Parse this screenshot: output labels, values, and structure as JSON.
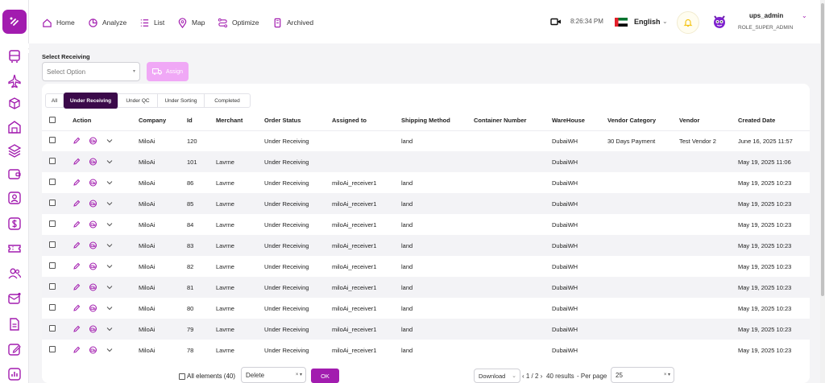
{
  "nav": {
    "home": "Home",
    "analyze": "Analyze",
    "list": "List",
    "map": "Map",
    "optimize": "Optimize",
    "archived": "Archived"
  },
  "header": {
    "time": "8:26:34 PM",
    "language": "English",
    "username": "ups_admin",
    "role": "ROLE_SUPER_ADMIN"
  },
  "filter": {
    "label": "Select Receiving",
    "placeholder": "Select Option",
    "assign_label": "Assign"
  },
  "tabs": [
    "All",
    "Under Receiving",
    "Under QC",
    "Under Sorting",
    "Completed"
  ],
  "active_tab": "Under Receiving",
  "table": {
    "columns": [
      "Action",
      "Company",
      "Id",
      "Merchant",
      "Order Status",
      "Assigned to",
      "Shipping Method",
      "Container Number",
      "WareHouse",
      "Vendor Category",
      "Vendor",
      "Created Date"
    ],
    "rows": [
      [
        "MiloAi",
        "120",
        "",
        "Under Receiving",
        "",
        "land",
        "",
        "DubaiWH",
        "30 Days Payment",
        "Test Vendor 2",
        "June 16, 2025 11:57"
      ],
      [
        "MiloAi",
        "101",
        "Lavrne",
        "Under Receiving",
        "",
        "",
        "",
        "DubaiWH",
        "",
        "",
        "May 19, 2025 11:06"
      ],
      [
        "MiloAi",
        "86",
        "Lavrne",
        "Under Receiving",
        "miloAi_receiver1",
        "land",
        "",
        "DubaiWH",
        "",
        "",
        "May 19, 2025 10:23"
      ],
      [
        "MiloAi",
        "85",
        "Lavrne",
        "Under Receiving",
        "miloAi_receiver1",
        "land",
        "",
        "DubaiWH",
        "",
        "",
        "May 19, 2025 10:23"
      ],
      [
        "MiloAi",
        "84",
        "Lavrne",
        "Under Receiving",
        "miloAi_receiver1",
        "land",
        "",
        "DubaiWH",
        "",
        "",
        "May 19, 2025 10:23"
      ],
      [
        "MiloAi",
        "83",
        "Lavrne",
        "Under Receiving",
        "miloAi_receiver1",
        "land",
        "",
        "DubaiWH",
        "",
        "",
        "May 19, 2025 10:23"
      ],
      [
        "MiloAi",
        "82",
        "Lavrne",
        "Under Receiving",
        "miloAi_receiver1",
        "land",
        "",
        "DubaiWH",
        "",
        "",
        "May 19, 2025 10:23"
      ],
      [
        "MiloAi",
        "81",
        "Lavrne",
        "Under Receiving",
        "miloAi_receiver1",
        "land",
        "",
        "DubaiWH",
        "",
        "",
        "May 19, 2025 10:23"
      ],
      [
        "MiloAi",
        "80",
        "Lavrne",
        "Under Receiving",
        "miloAi_receiver1",
        "land",
        "",
        "DubaiWH",
        "",
        "",
        "May 19, 2025 10:23"
      ],
      [
        "MiloAi",
        "79",
        "Lavrne",
        "Under Receiving",
        "miloAi_receiver1",
        "land",
        "",
        "DubaiWH",
        "",
        "",
        "May 19, 2025 10:23"
      ],
      [
        "MiloAi",
        "78",
        "Lavrne",
        "Under Receiving",
        "miloAi_receiver1",
        "land",
        "",
        "DubaiWH",
        "",
        "",
        "May 19, 2025 10:23"
      ]
    ]
  },
  "footer": {
    "all_elements": "All elements (40)",
    "bulk_action": "Delete",
    "ok": "OK",
    "download": "Download",
    "pagination": "‹ 1 / 2 ›",
    "results": "40 results",
    "per_page_label": "- Per page",
    "per_page": "25"
  },
  "colors": {
    "brand": "#a21caf",
    "active_tab": "#3b0a4a",
    "assign_button": "#f0a8f6",
    "bell": "#f5c518"
  },
  "icons": {
    "sidebar": [
      "bus-icon",
      "plane-icon",
      "box-icon",
      "warehouse-icon",
      "layers-icon",
      "wallet-icon",
      "user-icon",
      "dollar-icon",
      "ticket-icon",
      "users-icon",
      "mail-icon",
      "document-icon",
      "edit-icon",
      "chart-icon"
    ]
  }
}
